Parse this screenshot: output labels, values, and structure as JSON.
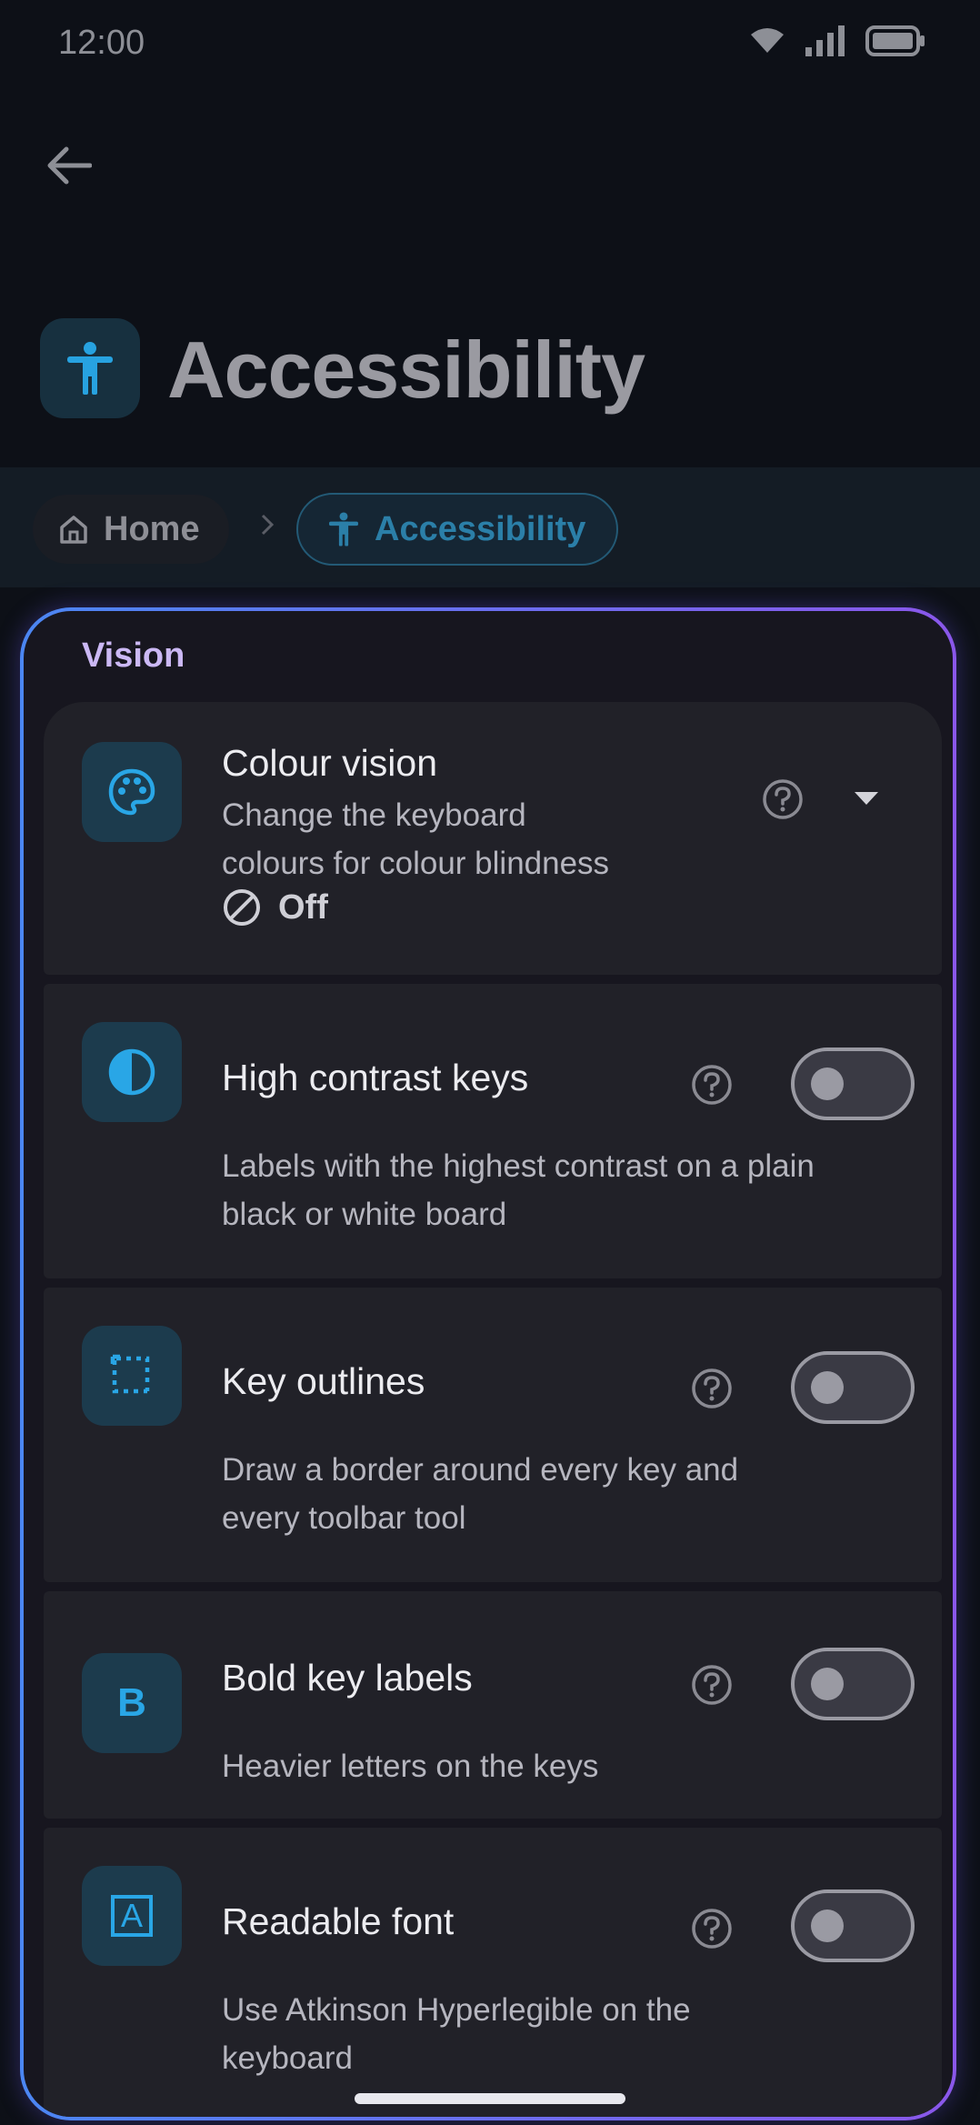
{
  "status_bar": {
    "time": "12:00"
  },
  "header": {
    "title": "Accessibility"
  },
  "breadcrumb": {
    "home": "Home",
    "current": "Accessibility"
  },
  "section": {
    "title": "Vision"
  },
  "settings": [
    {
      "title": "Colour vision",
      "description_lines": [
        "Change the keyboard",
        "colours for colour blindness"
      ],
      "value": "Off",
      "icon": "palette-icon"
    },
    {
      "title": "High contrast keys",
      "description_lines": [
        "Labels with the highest contrast on a plain",
        "black or white board"
      ],
      "toggle_on": false,
      "icon": "contrast-icon"
    },
    {
      "title": "Key outlines",
      "description_lines": [
        "Draw a border around every key and",
        "every toolbar tool"
      ],
      "toggle_on": false,
      "icon": "key-outline-icon"
    },
    {
      "title": "Bold key labels",
      "description_lines": [
        "Heavier letters on the keys"
      ],
      "toggle_on": false,
      "icon": "bold-icon",
      "icon_text": "B"
    },
    {
      "title": "Readable font",
      "description_lines": [
        "Use Atkinson Hyperlegible on the",
        "keyboard"
      ],
      "toggle_on": false,
      "icon": "readable-font-icon",
      "icon_text": "A"
    }
  ],
  "colors": {
    "accent": "#29a6e6",
    "section_title": "#cbb8f4",
    "card_border_start": "#4b86f2",
    "card_border_end": "#8a57ea"
  }
}
